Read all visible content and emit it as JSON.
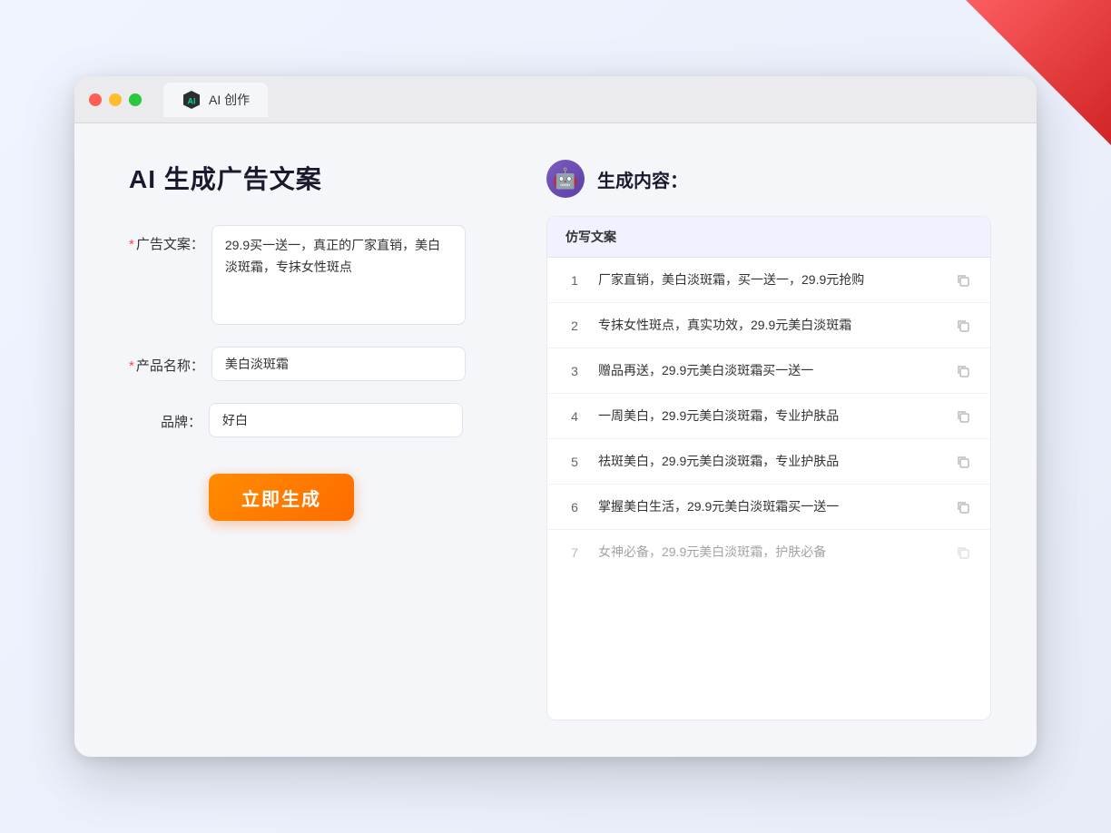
{
  "decorative": {
    "corner": true
  },
  "browser": {
    "tab_label": "AI 创作",
    "traffic_lights": [
      "red",
      "yellow",
      "green"
    ]
  },
  "left_panel": {
    "page_title": "AI 生成广告文案",
    "form": {
      "ad_copy_label": "广告文案：",
      "ad_copy_required": true,
      "ad_copy_value": "29.9买一送一，真正的厂家直销，美白淡斑霜，专抹女性斑点",
      "product_name_label": "产品名称：",
      "product_name_required": true,
      "product_name_value": "美白淡斑霜",
      "brand_label": "品牌：",
      "brand_required": false,
      "brand_value": "好白"
    },
    "generate_button": "立即生成"
  },
  "right_panel": {
    "title": "生成内容：",
    "table_header": "仿写文案",
    "results": [
      {
        "num": 1,
        "text": "厂家直销，美白淡斑霜，买一送一，29.9元抢购",
        "dimmed": false
      },
      {
        "num": 2,
        "text": "专抹女性斑点，真实功效，29.9元美白淡斑霜",
        "dimmed": false
      },
      {
        "num": 3,
        "text": "赠品再送，29.9元美白淡斑霜买一送一",
        "dimmed": false
      },
      {
        "num": 4,
        "text": "一周美白，29.9元美白淡斑霜，专业护肤品",
        "dimmed": false
      },
      {
        "num": 5,
        "text": "祛斑美白，29.9元美白淡斑霜，专业护肤品",
        "dimmed": false
      },
      {
        "num": 6,
        "text": "掌握美白生活，29.9元美白淡斑霜买一送一",
        "dimmed": false
      },
      {
        "num": 7,
        "text": "女神必备，29.9元美白淡斑霜，护肤必备",
        "dimmed": true
      }
    ]
  }
}
